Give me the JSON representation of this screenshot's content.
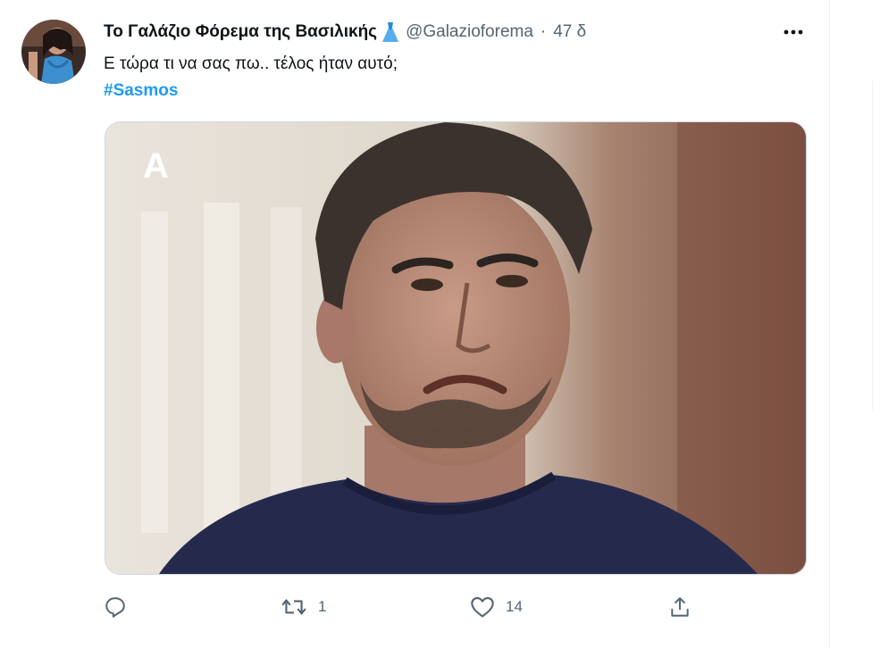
{
  "tweet": {
    "display_name": "Το Γαλάζιο Φόρεμα της Βασιλικής",
    "name_emoji": "dress-icon",
    "handle": "@Galazioforema",
    "separator": "·",
    "time": "47 δ",
    "text": "Ε τώρα τι να σας πω.. τέλος ήταν αυτό;",
    "hashtag": "#Sasmos",
    "media": {
      "channel_logo": "Α",
      "description_icon": "video-still"
    },
    "actions": {
      "reply_count": "",
      "retweet_count": "1",
      "like_count": "14",
      "share_count": ""
    }
  },
  "colors": {
    "accent": "#1d9bf0",
    "muted": "#536471",
    "text": "#0f1419"
  }
}
